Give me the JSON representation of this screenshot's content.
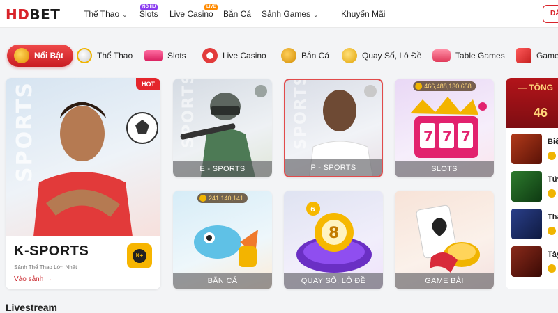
{
  "brand": {
    "logo_text_1": "HD",
    "logo_text_2": "BET",
    "accent": "#d8232a"
  },
  "topnav": {
    "items": [
      {
        "label": "Thể Thao",
        "has_dropdown": true
      },
      {
        "label": "Slots",
        "badge": "NỔ HŨ"
      },
      {
        "label": "Live Casino",
        "badge": "LIVE"
      },
      {
        "label": "Bắn Cá"
      },
      {
        "label": "Sảnh Games",
        "has_dropdown": true
      },
      {
        "label": "Khuyến Mãi"
      }
    ],
    "login_label": "ĐĂ"
  },
  "categories": [
    {
      "label": "Nổi Bật",
      "icon": "crown-icon",
      "active": true
    },
    {
      "label": "Thể Thao",
      "icon": "soccer-ball-icon"
    },
    {
      "label": "Slots",
      "icon": "slot-777-icon"
    },
    {
      "label": "Live Casino",
      "icon": "poker-chip-icon"
    },
    {
      "label": "Bắn Cá",
      "icon": "fish-icon"
    },
    {
      "label": "Quay Số, Lô Đề",
      "icon": "lottery-ball-icon"
    },
    {
      "label": "Table Games",
      "icon": "card-table-icon"
    },
    {
      "label": "Game",
      "icon": "dice-icon"
    }
  ],
  "feature": {
    "badge": "HOT",
    "watermark": "SPORTS",
    "title": "K-SPORTS",
    "subtitle": "Sảnh Thể Thao Lớn Nhất",
    "link": "Vào sảnh",
    "logo_text": "K+"
  },
  "tiles": [
    {
      "label": "E - SPORTS",
      "watermark": "SPORTS"
    },
    {
      "label": "P - SPORTS",
      "watermark": "SPORTS",
      "selected": true
    },
    {
      "label": "SLOTS",
      "jackpot": "466,488,130,658"
    },
    {
      "label": "BẮN CÁ",
      "jackpot": "241,140,141"
    },
    {
      "label": "QUAY SỐ, LÔ ĐỀ"
    },
    {
      "label": "GAME BÀI"
    }
  ],
  "jackpot_panel": {
    "title": "TỔNG",
    "amount": "46",
    "items": [
      {
        "name": "Biệ"
      },
      {
        "name": "Tứ"
      },
      {
        "name": "Tha"
      },
      {
        "name": "Tây"
      }
    ]
  },
  "section": {
    "livestream_title": "Livestream"
  }
}
